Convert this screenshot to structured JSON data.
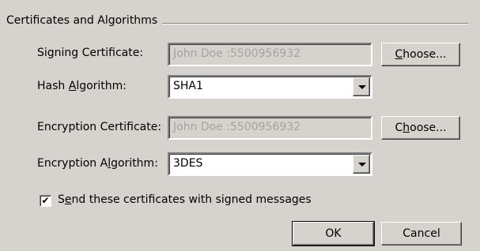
{
  "group": {
    "title": "Certificates and Algorithms"
  },
  "signing_certificate": {
    "label_pre": "Signing Certificate:",
    "value": "John Doe :5500956932",
    "choose_pre": "",
    "choose_key": "C",
    "choose_post": "hoose..."
  },
  "hash_algorithm": {
    "label_pre": "Hash ",
    "label_key": "A",
    "label_post": "lgorithm:",
    "value": "SHA1"
  },
  "encryption_certificate": {
    "label_pre": "Encryption Certificate:",
    "value": "John Doe :5500956932",
    "choose_pre": "C",
    "choose_key": "h",
    "choose_post": "oose..."
  },
  "encryption_algorithm": {
    "label_pre": "Encryption A",
    "label_key": "l",
    "label_post": "gorithm:",
    "value": "3DES"
  },
  "send_certs": {
    "checked": true,
    "check_glyph": "✔",
    "label_pre": "S",
    "label_key": "e",
    "label_post": "nd these certificates with signed messages"
  },
  "buttons": {
    "ok": "OK",
    "cancel": "Cancel"
  },
  "colors": {
    "face": "#d6d3ce",
    "disabled_text": "#a3a3a3"
  }
}
